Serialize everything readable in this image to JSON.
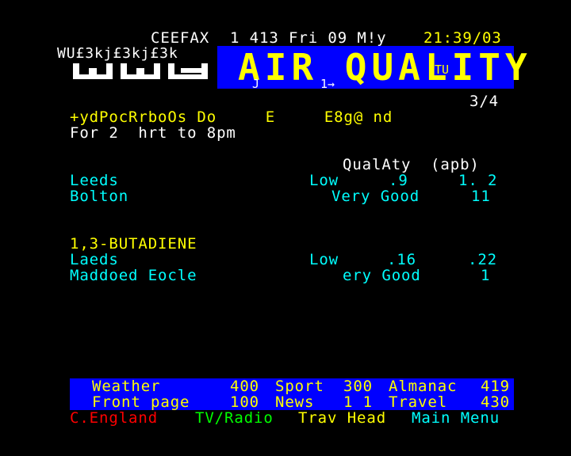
{
  "header": {
    "service": "CEEFAX",
    "page_info": "1 413 Fri 09 M!y",
    "clock": "21:39/03",
    "logo_garble": "WU£3kj£3kj£3k"
  },
  "banner": {
    "title": "AIR QUALITY",
    "sub_tu": "TU",
    "sub_j": "J",
    "sub_arrow": "1→"
  },
  "page_counter": "3/4",
  "intro": {
    "line1": "+ydPocRrboOs Do     E     E8g@ nd",
    "line2": "For 2  hrt to 8pm"
  },
  "table_header": "QualAty  (apb)",
  "section1": {
    "rows": [
      {
        "place": "Leeds",
        "quality": "Low",
        "v1": ".9",
        "v2": "1. 2"
      },
      {
        "place": "Bolton",
        "quality": "Very Good",
        "v1": "",
        "v2": "11"
      }
    ]
  },
  "section2": {
    "title": "1,3-BUTADIENE",
    "rows": [
      {
        "place": "Laeds",
        "quality": "Low",
        "v1": ".16",
        "v2": ".22"
      },
      {
        "place": "Maddoed Eocle",
        "quality": "ery Good",
        "v1": "",
        "v2": "1"
      }
    ]
  },
  "footer": {
    "row1": [
      {
        "label": "Weather",
        "page": "400"
      },
      {
        "label": "Sport",
        "page": "300"
      },
      {
        "label": "Almanac",
        "page": "419"
      }
    ],
    "row2": [
      {
        "label": "Front page",
        "page": "100"
      },
      {
        "label": "News",
        "page": "1 1"
      },
      {
        "label": "Travel",
        "page": "430"
      }
    ],
    "fastext": {
      "red": "C.England",
      "green": "TV/Radio",
      "yellow": "Trav Head",
      "cyan": "Main Menu"
    }
  },
  "colors": {
    "background": "#000000",
    "banner_bg": "#0000ff",
    "yellow": "#ffff00",
    "cyan": "#00ffff",
    "red": "#ff0000",
    "green": "#00ff00",
    "white": "#ffffff"
  }
}
